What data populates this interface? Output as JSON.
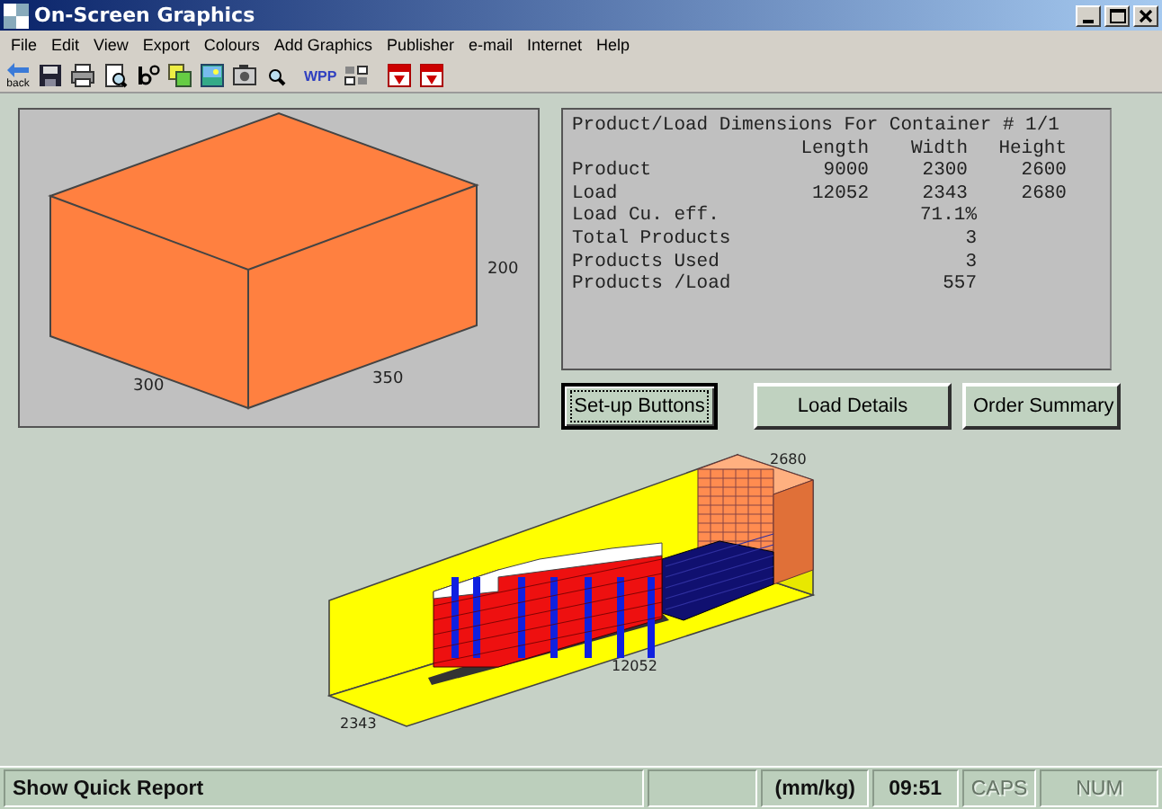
{
  "window": {
    "title": "On-Screen Graphics"
  },
  "menu": [
    "File",
    "Edit",
    "View",
    "Export",
    "Colours",
    "Add Graphics",
    "Publisher",
    "e-mail",
    "Internet",
    "Help"
  ],
  "toolbar": [
    {
      "kind": "back",
      "label": "back"
    },
    {
      "kind": "save"
    },
    {
      "kind": "print"
    },
    {
      "kind": "preview"
    },
    {
      "kind": "letters"
    },
    {
      "kind": "copy"
    },
    {
      "kind": "picture"
    },
    {
      "kind": "camera"
    },
    {
      "kind": "zoom"
    },
    {
      "kind": "text",
      "label": "WPP"
    },
    {
      "kind": "grid"
    },
    {
      "kind": "pdf"
    },
    {
      "kind": "pdf"
    }
  ],
  "product_view": {
    "height_label": "200",
    "depth_label": "300",
    "width_label": "350"
  },
  "report": {
    "title": "Product/Load Dimensions For Container # 1/1",
    "columns": [
      "Length",
      "Width",
      "Height"
    ],
    "rows": [
      {
        "label": "Product",
        "values": [
          "9000",
          "2300",
          "2600"
        ]
      },
      {
        "label": "Load",
        "values": [
          "12052",
          "2343",
          "2680"
        ]
      }
    ],
    "summary": [
      {
        "label": "Load Cu. eff.",
        "value": "71.1%"
      },
      {
        "label": "Total Products",
        "value": "3"
      },
      {
        "label": "Products Used",
        "value": "3"
      },
      {
        "label": "Products /Load",
        "value": "557"
      }
    ]
  },
  "buttons": [
    {
      "label": "Set-up Buttons",
      "focused": true
    },
    {
      "label": "Load Details",
      "focused": false
    },
    {
      "label": "Order Summary",
      "focused": false
    }
  ],
  "container_view": {
    "height_label": "2680",
    "length_label": "12052",
    "width_label": "2343"
  },
  "status_bar": {
    "message": "Show Quick Report",
    "indicators": [
      {
        "text": "(mm/kg)",
        "disabled": false
      },
      {
        "text": "09:51",
        "disabled": false
      },
      {
        "text": "CAPS",
        "disabled": true
      },
      {
        "text": "NUM",
        "disabled": true
      }
    ]
  }
}
